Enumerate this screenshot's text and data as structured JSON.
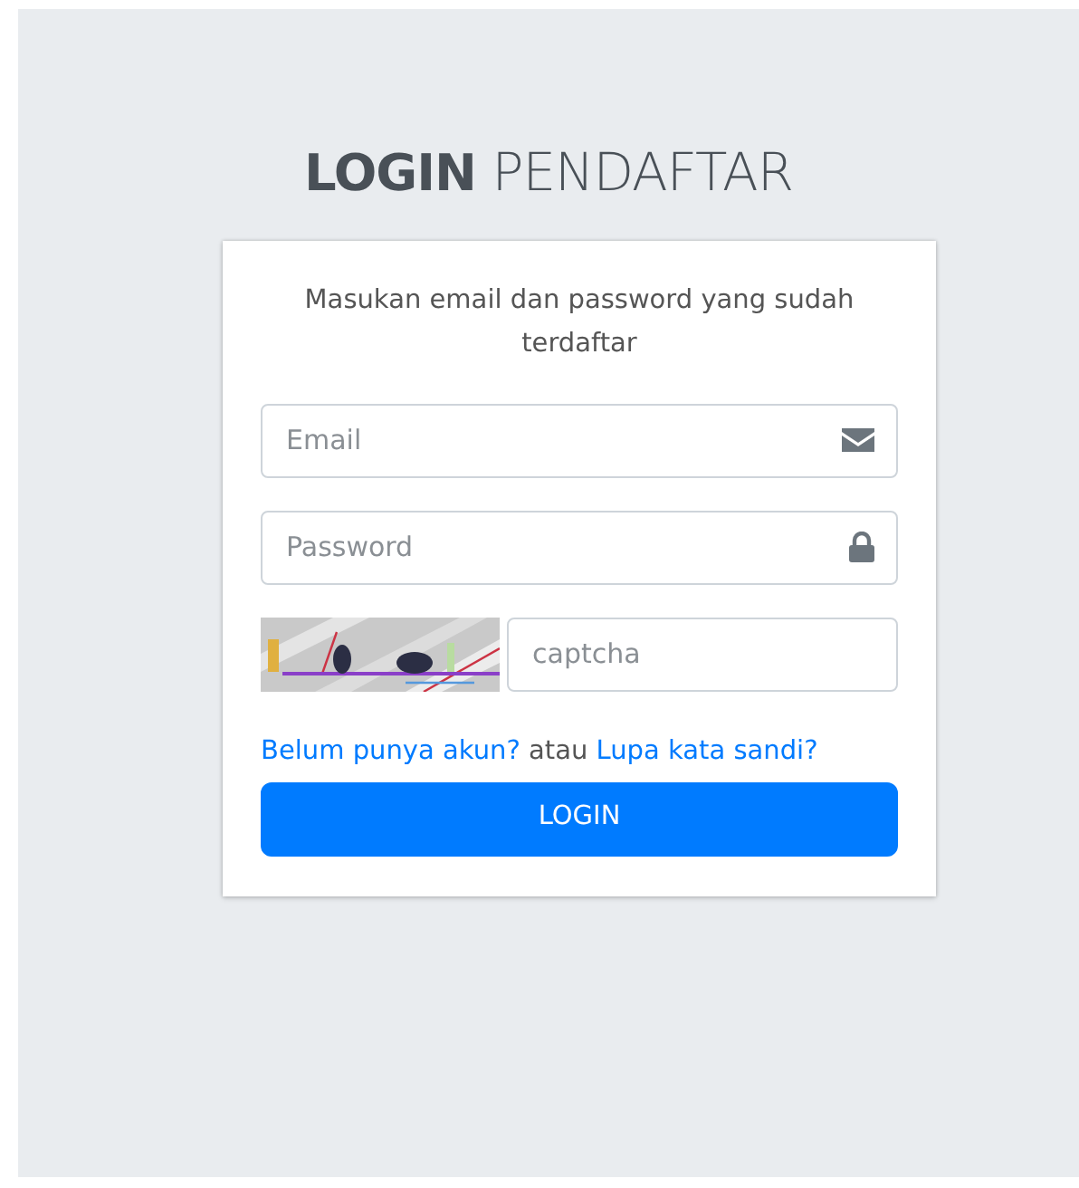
{
  "title": "**LOGIN** PENDAFTAR",
  "card": {
    "message": "Masukan email dan password yang sudah terdaftar",
    "fields": [
      {
        "kind": "email",
        "placeholder": "Email"
      },
      {
        "kind": "password",
        "placeholder": "Password"
      }
    ],
    "captcha": {
      "placeholder": "captcha"
    },
    "links_line": [
      {
        "kind": "link",
        "text": "Belum punya akun?"
      },
      {
        "kind": "text",
        "text": "atau"
      },
      {
        "kind": "link",
        "text": "Lupa kata sandi?"
      }
    ],
    "button": "LOGIN"
  }
}
